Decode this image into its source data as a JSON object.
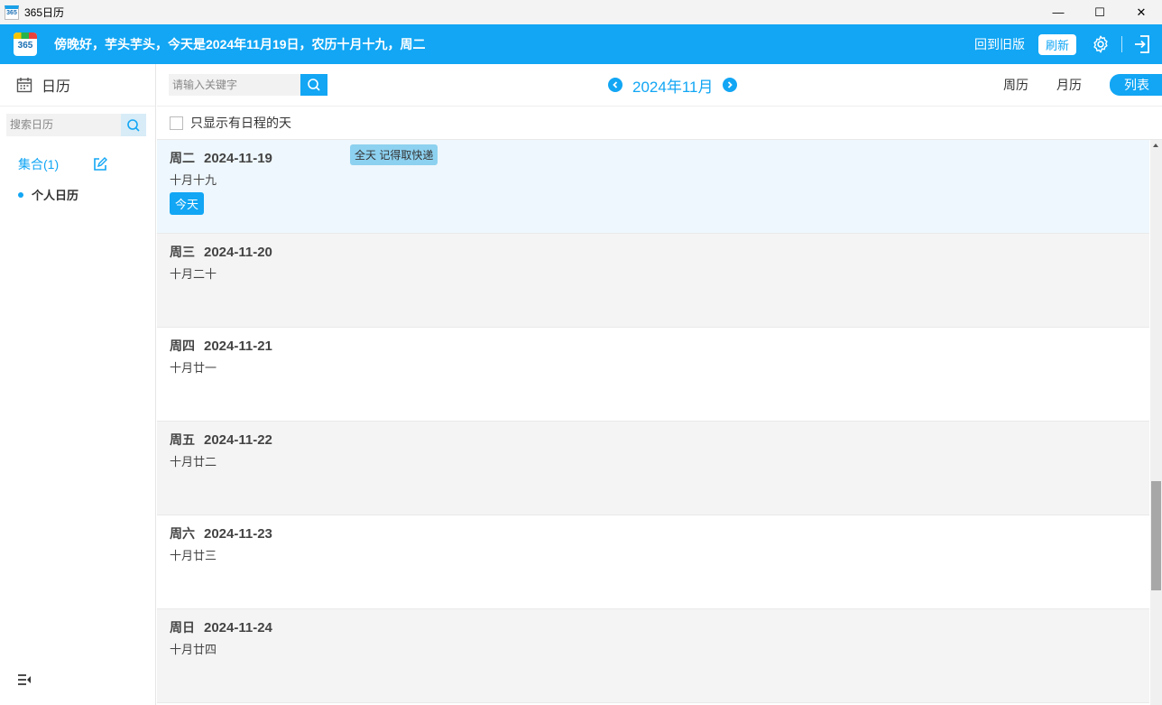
{
  "window": {
    "app_icon_text": "365",
    "title": "365日历",
    "minimize_symbol": "—",
    "maximize_symbol": "☐",
    "close_symbol": "✕"
  },
  "header": {
    "logo_text": "365",
    "greeting": "傍晚好，芋头芋头，今天是2024年11月19日，农历十月十九，周二",
    "back_to_old": "回到旧版",
    "refresh": "刷新",
    "icons": [
      "settings-gear-icon",
      "logout-icon"
    ]
  },
  "sidebar": {
    "title": "日历",
    "search_placeholder": "搜索日历",
    "group_label": "集合(1)",
    "items": [
      {
        "label": "个人日历"
      }
    ],
    "icons": [
      "calendar-icon",
      "search-icon",
      "edit-icon",
      "collapse-menu-icon"
    ]
  },
  "toolbar": {
    "search_placeholder": "请输入关键字",
    "month": "2024年11月",
    "view_tabs": [
      {
        "label": "周历",
        "active": false
      },
      {
        "label": "月历",
        "active": false
      },
      {
        "label": "列表",
        "active": true
      }
    ]
  },
  "filter": {
    "label": "只显示有日程的天",
    "checked": false
  },
  "days": [
    {
      "weekday": "周二",
      "date": "2024-11-19",
      "lunar": "十月十九",
      "today_label": "今天",
      "event": "全天 记得取快递",
      "highlight": true
    },
    {
      "weekday": "周三",
      "date": "2024-11-20",
      "lunar": "十月二十"
    },
    {
      "weekday": "周四",
      "date": "2024-11-21",
      "lunar": "十月廿一"
    },
    {
      "weekday": "周五",
      "date": "2024-11-22",
      "lunar": "十月廿二"
    },
    {
      "weekday": "周六",
      "date": "2024-11-23",
      "lunar": "十月廿三"
    },
    {
      "weekday": "周日",
      "date": "2024-11-24",
      "lunar": "十月廿四"
    }
  ],
  "colors": {
    "accent": "#12a6f4",
    "event_bg": "#8dd1f0",
    "today_row_bg": "#eef7fd",
    "alt_row_bg": "#f4f4f5",
    "white_row_bg": "#ffffff"
  }
}
